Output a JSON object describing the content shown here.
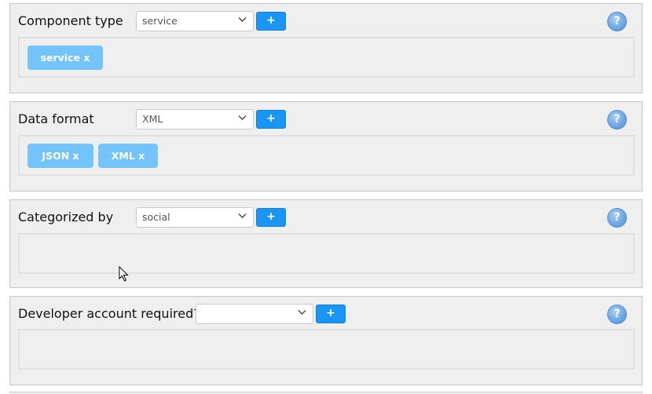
{
  "panels": [
    {
      "label": "Component type",
      "selected": "service",
      "add_label": "+",
      "help_label": "?",
      "tags": [
        "service x"
      ]
    },
    {
      "label": "Data format",
      "selected": "XML",
      "add_label": "+",
      "help_label": "?",
      "tags": [
        "JSON x",
        "XML x"
      ]
    },
    {
      "label": "Categorized by",
      "selected": "social",
      "add_label": "+",
      "help_label": "?",
      "tags": []
    },
    {
      "label": "Developer account required?",
      "selected": "",
      "add_label": "+",
      "help_label": "?",
      "tags": []
    }
  ],
  "colors": {
    "panel_bg": "#efefef",
    "add_button": "#1a95f3",
    "tag": "#72c4fa",
    "help": "#6ea8e6"
  }
}
